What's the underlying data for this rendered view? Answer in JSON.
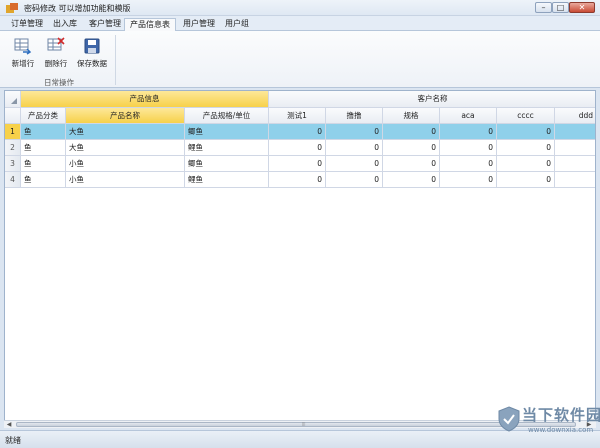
{
  "window": {
    "title": "密码修改  可以增加功能和模版",
    "min_symbol": "–",
    "max_symbol": "□",
    "close_symbol": "✕",
    "icon": "app-icon"
  },
  "tabs": [
    {
      "label": "订单管理",
      "active": false
    },
    {
      "label": "出入库",
      "active": false
    },
    {
      "label": "客户管理",
      "active": false
    },
    {
      "label": "产品信息表",
      "active": true
    },
    {
      "label": "用户管理",
      "active": false
    },
    {
      "label": "用户组",
      "active": false
    }
  ],
  "ribbon": {
    "buttons": [
      {
        "label": "新增行",
        "icon": "add-row-icon"
      },
      {
        "label": "删除行",
        "icon": "delete-row-icon"
      },
      {
        "label": "保存数据",
        "icon": "save-icon"
      }
    ],
    "group_label": "日常操作"
  },
  "grid": {
    "band_headers": {
      "product_info": "产品信息",
      "customer_name": "客户名称"
    },
    "columns": [
      "产品分类",
      "产品名称",
      "产品规格/单位",
      "测试1",
      "撸撸",
      "规格",
      "aca",
      "cccc",
      "ddd"
    ],
    "rows": [
      {
        "no": "1",
        "cells": [
          "鱼",
          "大鱼",
          "鲫鱼",
          "0",
          "0",
          "0",
          "0",
          "0",
          ""
        ]
      },
      {
        "no": "2",
        "cells": [
          "鱼",
          "大鱼",
          "鲤鱼",
          "0",
          "0",
          "0",
          "0",
          "0",
          ""
        ]
      },
      {
        "no": "3",
        "cells": [
          "鱼",
          "小鱼",
          "鲫鱼",
          "0",
          "0",
          "0",
          "0",
          "0",
          ""
        ]
      },
      {
        "no": "4",
        "cells": [
          "鱼",
          "小鱼",
          "鲤鱼",
          "0",
          "0",
          "0",
          "0",
          "0",
          ""
        ]
      }
    ],
    "selected_row": 1
  },
  "scrollbar": {
    "grip": "⦙⦙⦙"
  },
  "status": {
    "text": "就绪"
  },
  "watermark": {
    "main": "当下软件园",
    "sub": "www.downxia.com"
  },
  "colors": {
    "selected_row": "#8fd0ea",
    "header_highlight": "#f7d14a",
    "accent": "#f7d14a"
  }
}
